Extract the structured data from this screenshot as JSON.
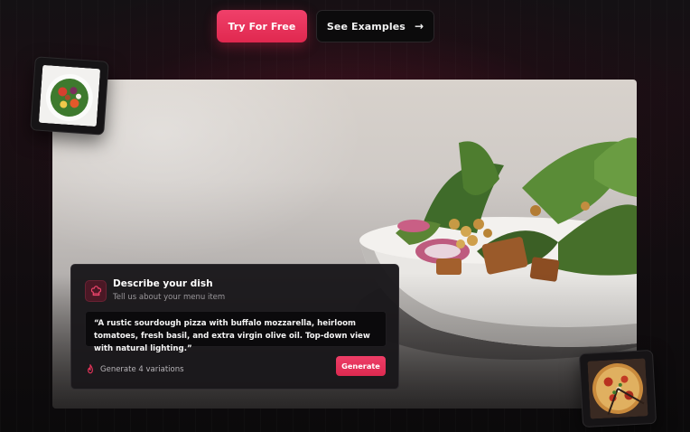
{
  "cta": {
    "primary_label": "Try For Free",
    "secondary_label": "See Examples",
    "secondary_icon": "arrow-right-icon"
  },
  "hero": {
    "image": "salad-bowl-photo"
  },
  "thumbnails": [
    {
      "image": "salad-bowl-thumbnail"
    },
    {
      "image": "pizza-thumbnail"
    }
  ],
  "card": {
    "icon": "chef-hat-icon",
    "title": "Describe your dish",
    "subtitle": "Tell us about your menu item",
    "prompt": "“A rustic sourdough pizza with buffalo mozzarella, heirloom tomatoes, fresh basil, and extra virgin olive oil. Top-down view with natural lighting.”",
    "variations_icon": "flame-icon",
    "variations_label": "Generate 4 variations",
    "generate_label": "Generate"
  },
  "colors": {
    "accent": "#e8345b",
    "background": "#0d0b0d",
    "card": "#1a181b"
  }
}
